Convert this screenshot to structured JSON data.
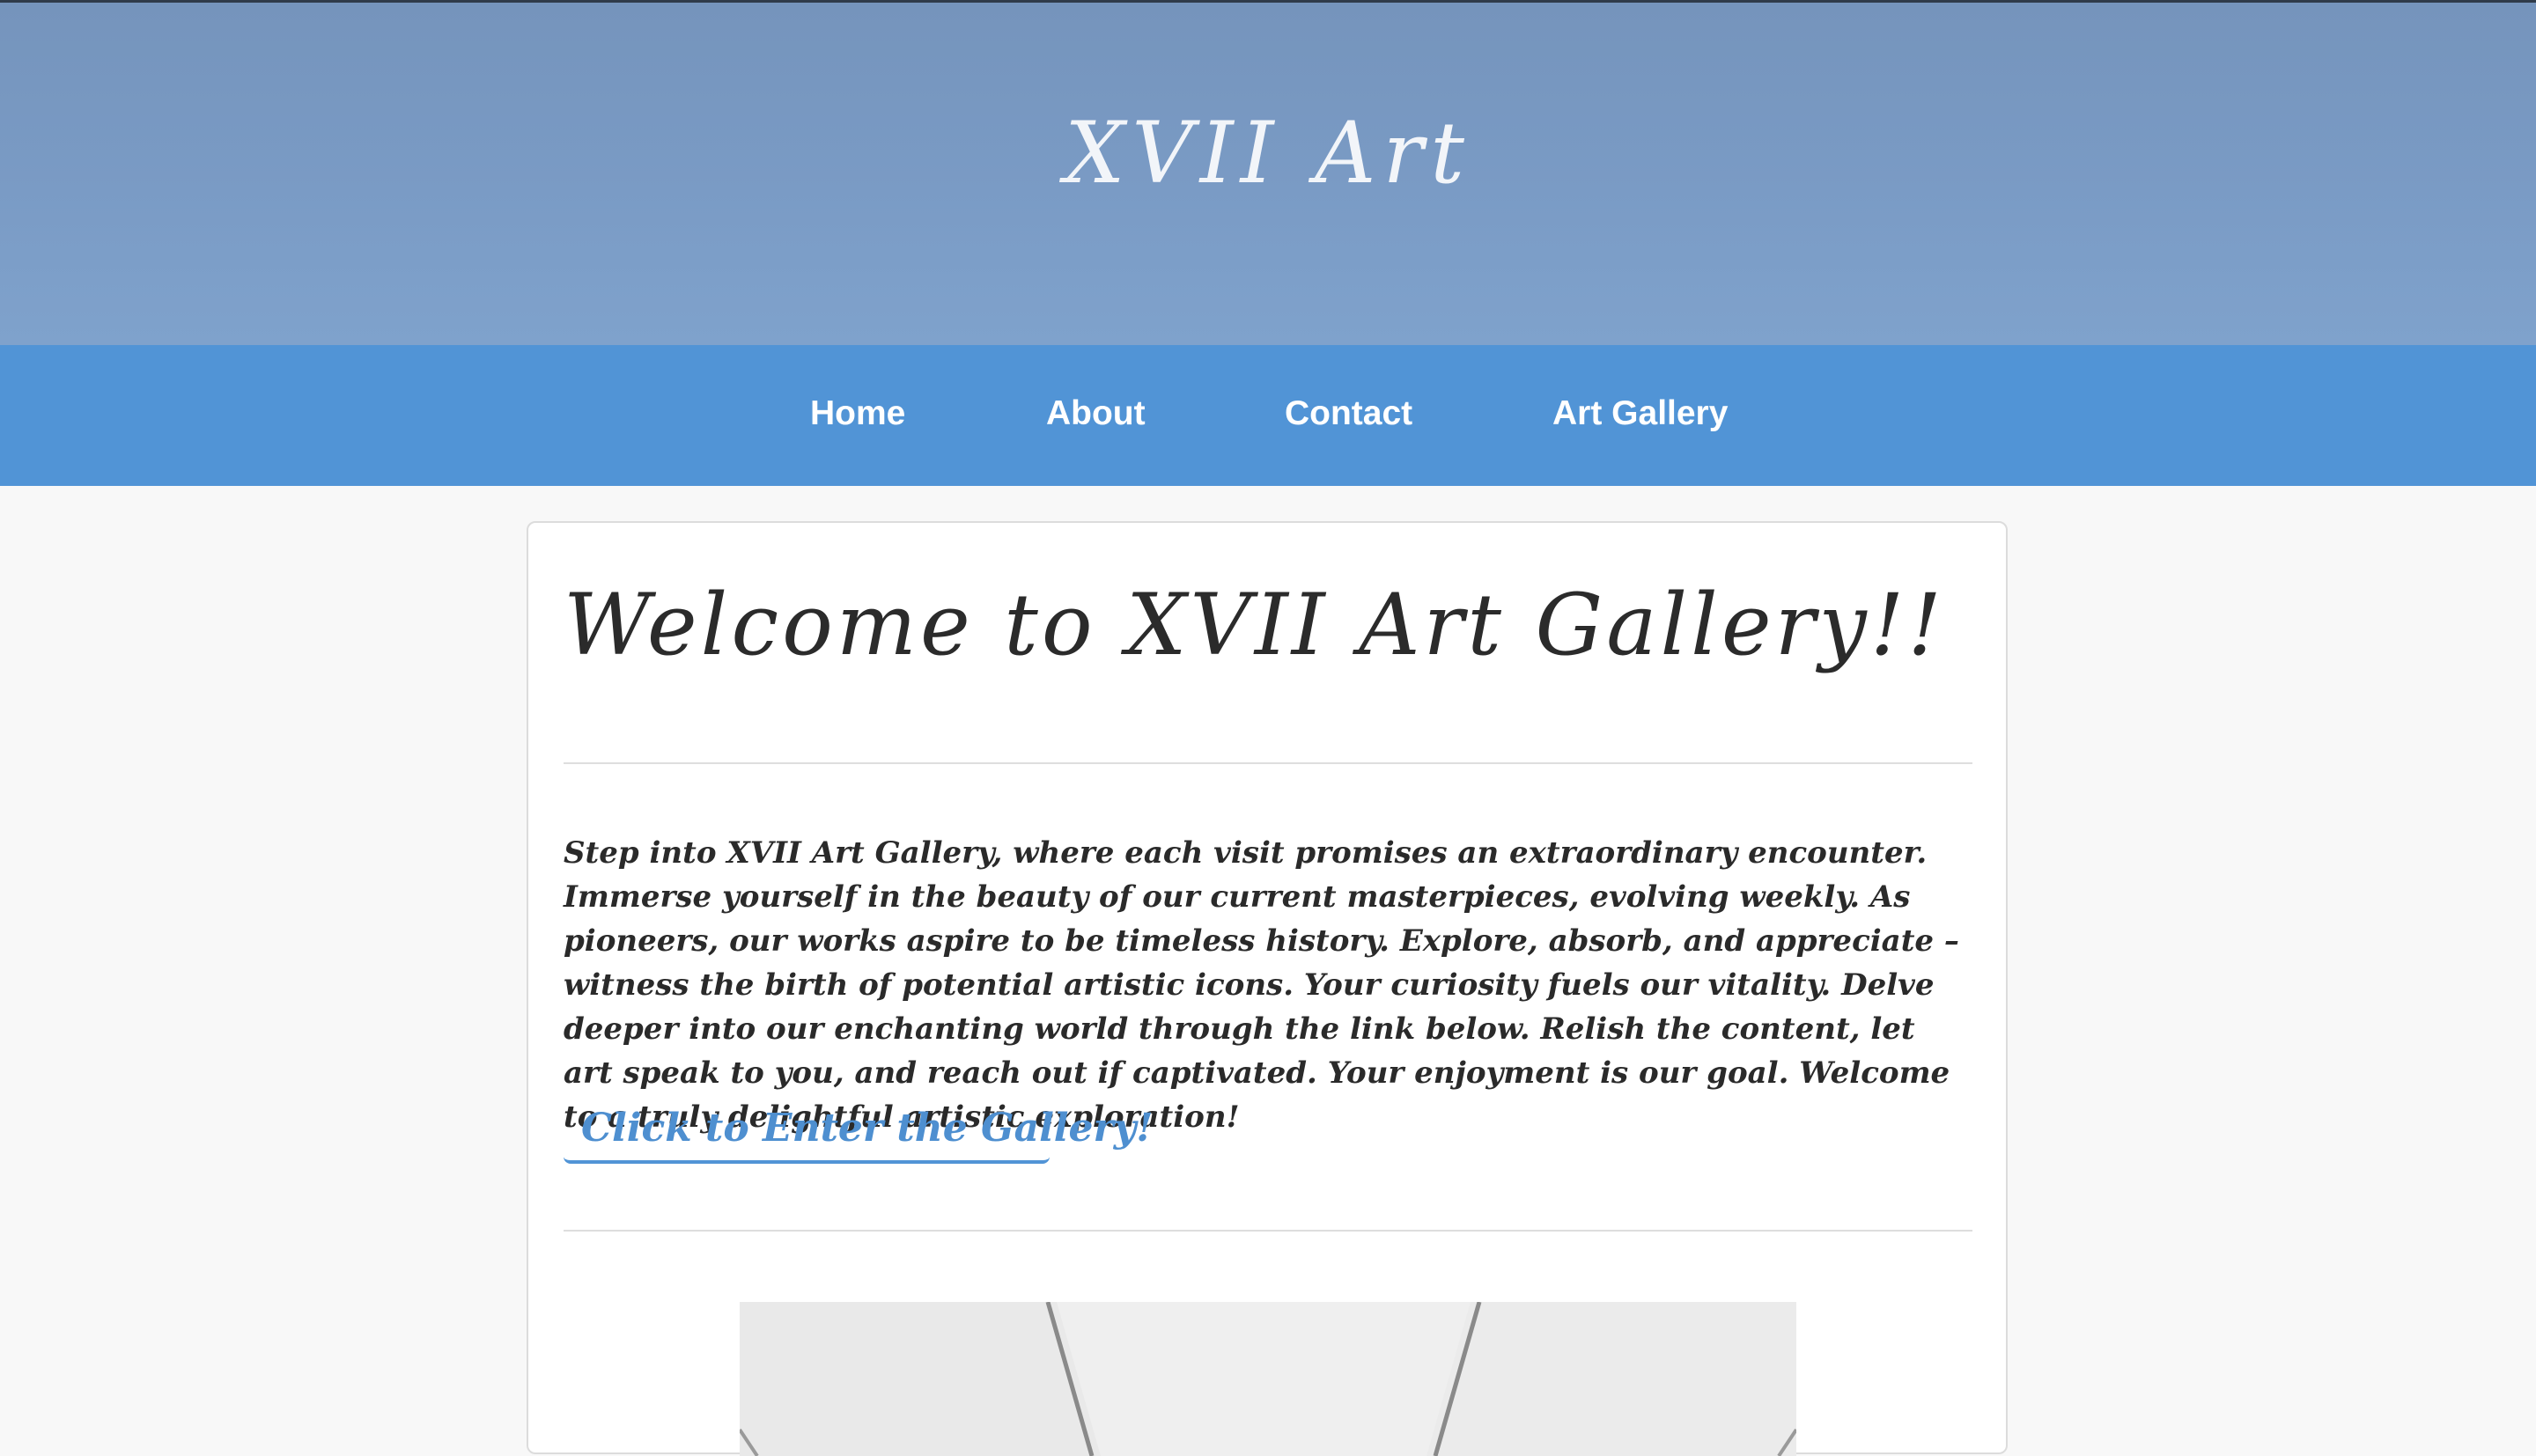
{
  "header": {
    "site_title": "XVII Art"
  },
  "nav": {
    "items": [
      {
        "label": "Home"
      },
      {
        "label": "About"
      },
      {
        "label": "Contact"
      },
      {
        "label": "Art Gallery"
      }
    ]
  },
  "main": {
    "heading": "Welcome to XVII Art Gallery!!",
    "intro": "Step into XVII Art Gallery, where each visit promises an extraordinary encounter. Immerse yourself in the beauty of our current masterpieces, evolving weekly. As pioneers, our works aspire to be timeless history. Explore, absorb, and appreciate – witness the birth of potential artistic icons. Your curiosity fuels our vitality. Delve deeper into our enchanting world through the link below. Relish the content, let art speak to you, and reach out if captivated. Your enjoyment is our goal. Welcome to a truly delightful artistic exploration!",
    "cta_label": "Click to Enter the Gallery!"
  },
  "colors": {
    "header_bg": "#7a9bc5",
    "nav_bg": "#5194d6",
    "link": "#4e8fd0",
    "page_bg": "#f8f8f8"
  }
}
